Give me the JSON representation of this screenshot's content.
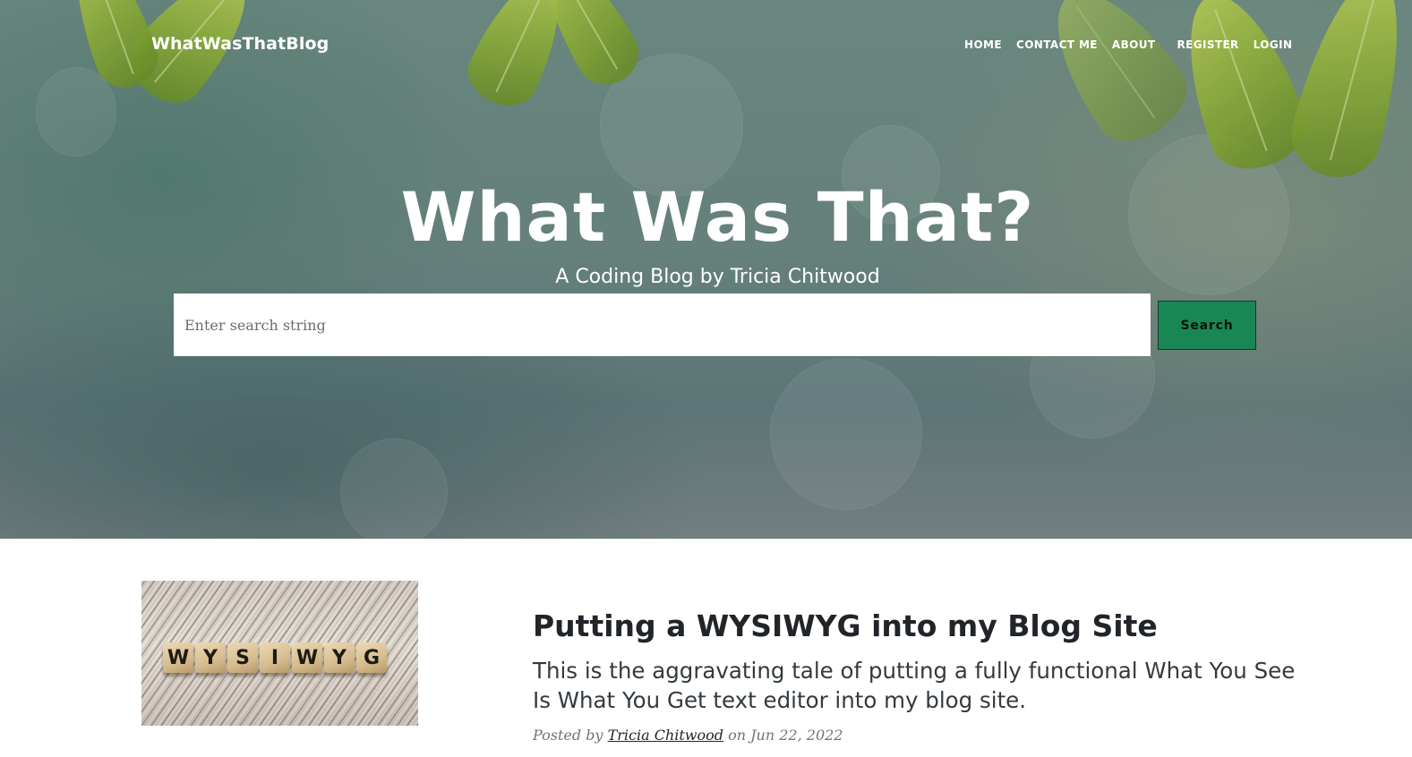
{
  "brand": "WhatWasThatBlog",
  "nav": {
    "home": "HOME",
    "contact": "CONTACT ME",
    "about": "ABOUT",
    "register": "REGISTER",
    "login": "LOGIN"
  },
  "hero": {
    "title": "What Was That?",
    "subtitle": "A Coding Blog by Tricia Chitwood"
  },
  "search": {
    "placeholder": "Enter search string",
    "value": "",
    "button_label": "Search"
  },
  "post": {
    "image_letters": [
      "W",
      "Y",
      "S",
      "I",
      "W",
      "Y",
      "G"
    ],
    "title": "Putting a WYSIWYG into my Blog Site",
    "subtitle": "This is the aggravating tale of putting a fully functional What You See Is What You Get text editor into my blog site.",
    "meta_prefix": "Posted by",
    "author": "Tricia Chitwood",
    "meta_on": "on",
    "date": "Jun 22, 2022"
  },
  "colors": {
    "search_button": "#198754",
    "heading_text": "#212529",
    "meta_text": "#6c757d"
  }
}
